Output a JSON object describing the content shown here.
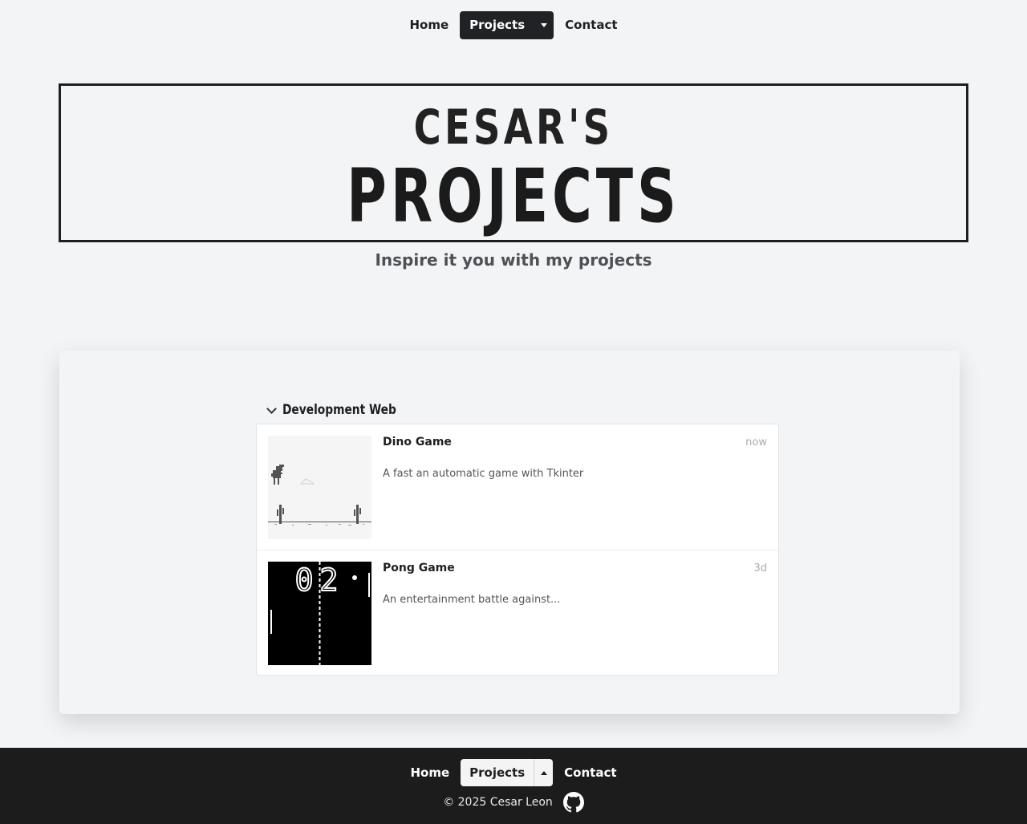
{
  "nav": {
    "home": "Home",
    "projects": "Projects",
    "contact": "Contact"
  },
  "hero": {
    "line1": "CESAR'S",
    "line2": "PROJECTS",
    "subtitle": "Inspire it you with my projects"
  },
  "group": {
    "label": "Development Web",
    "items": [
      {
        "title": "Dino Game",
        "time": "now",
        "description": "A fast an automatic game with Tkinter"
      },
      {
        "title": "Pong Game",
        "time": "3d",
        "description": "An entertainment battle against..."
      }
    ]
  },
  "pong_score": "02",
  "footer": {
    "home": "Home",
    "projects": "Projects",
    "contact": "Contact",
    "copyright": "© 2025 Cesar Leon"
  },
  "colors": {
    "background": "#f3f4f6",
    "dark": "#1c1c1c",
    "accent_button": "#202226"
  },
  "icons": [
    "chevron-down-icon",
    "caret-down-icon",
    "caret-up-icon",
    "github-icon"
  ]
}
